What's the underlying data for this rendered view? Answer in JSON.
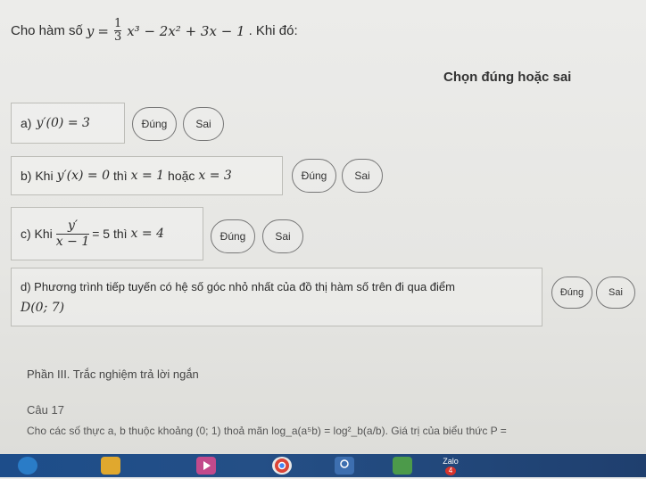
{
  "question": {
    "prefix": "Cho hàm số",
    "y": "y",
    "eq": "=",
    "frac_num": "1",
    "frac_den": "3",
    "rest": "x³ − 2x² + 3x − 1",
    "suffix": ". Khi đó:"
  },
  "section_label": "Chọn đúng hoặc sai",
  "statements": {
    "a": {
      "label": "a)",
      "math": "y′(0) = 3"
    },
    "b": {
      "label": "b) Khi",
      "math1": "y′(x) = 0",
      "mid": "thì",
      "math2": "x = 1",
      "or": "hoặc",
      "math3": "x = 3"
    },
    "c": {
      "label": "c) Khi",
      "frac_num": "y′",
      "frac_den": "x − 1",
      "eq": "= 5 thì",
      "math": "x = 4"
    },
    "d": {
      "line1": "d) Phương trình tiếp tuyến có hệ số góc nhỏ nhất của đồ thị hàm số trên đi qua điểm",
      "line2": "D(0; 7)"
    }
  },
  "buttons": {
    "true_label": "Đúng",
    "false_label": "Sai"
  },
  "part3": {
    "heading": "Phần III. Trắc nghiệm trả lời ngắn",
    "q_label": "Câu 17",
    "q_text": "Cho các số thực a, b thuộc khoảng (0; 1) thoả mãn log_a(a⁵b) = log²_b(a/b). Giá trị của biểu thức P ="
  },
  "taskbar": {
    "icons": [
      "edge-icon",
      "file-explorer-icon",
      "media-player-icon",
      "chrome-icon",
      "photos-icon",
      "zalo-icon"
    ],
    "zalo_label": "Zalo",
    "zalo_badge": "4"
  }
}
